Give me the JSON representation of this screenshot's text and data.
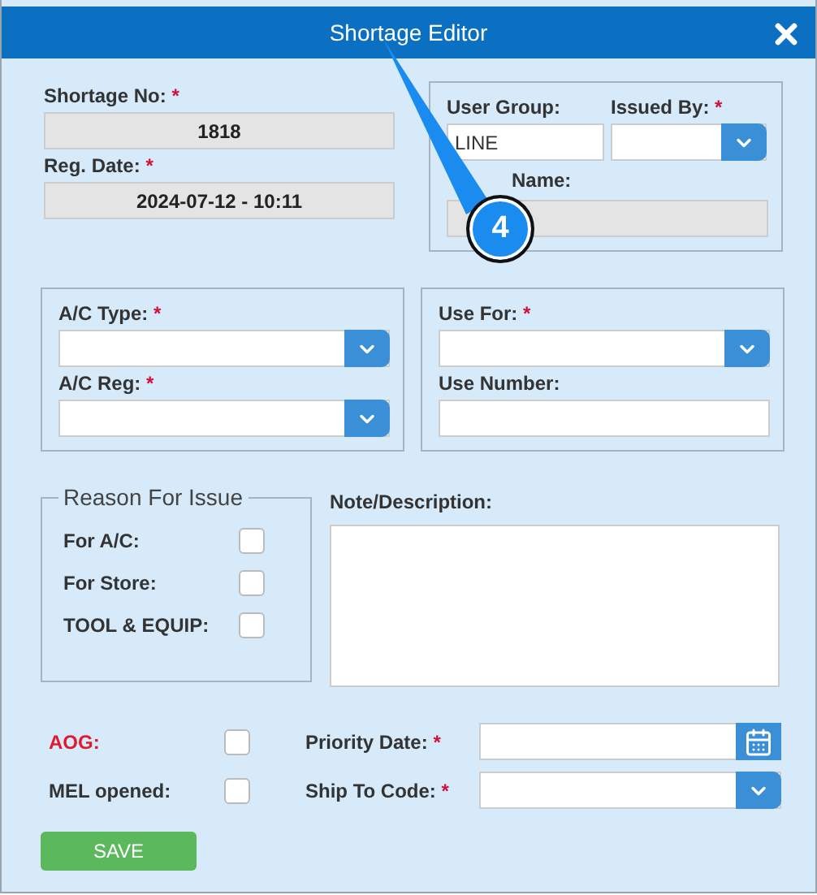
{
  "window": {
    "title": "Shortage Editor"
  },
  "shortage_no": {
    "label": "Shortage No:",
    "mark": "*",
    "kind": "readonly",
    "value": "1818"
  },
  "reg_date": {
    "label": "Reg. Date:",
    "mark": "*",
    "kind": "readonly",
    "value": "2024-07-12 - 10:11"
  },
  "user_group": {
    "label": "User Group:",
    "kind": "text",
    "value": "LINE"
  },
  "issued_by": {
    "label": "Issued By:",
    "mark": "*",
    "kind": "select"
  },
  "user_name": {
    "label": "Name:",
    "kind": "readonly"
  },
  "ac_type": {
    "label": "A/C Type:",
    "mark": "*",
    "kind": "select"
  },
  "ac_reg": {
    "label": "A/C Reg:",
    "mark": "*",
    "kind": "select"
  },
  "use_for": {
    "label": "Use For:",
    "mark": "*",
    "kind": "select"
  },
  "use_number": {
    "label": "Use Number:",
    "kind": "text"
  },
  "reason": {
    "legend": "Reason For Issue",
    "options": [
      {
        "label": "For A/C:",
        "checked": false
      },
      {
        "label": "For Store:",
        "checked": false
      },
      {
        "label": "TOOL & EQUIP:",
        "checked": false
      }
    ]
  },
  "note": {
    "label": "Note/Description:"
  },
  "flags": [
    {
      "label": "AOG:",
      "checked": false,
      "color": "#e0192e"
    },
    {
      "label": "MEL opened:",
      "checked": false,
      "color": "#333333"
    }
  ],
  "priority_date": {
    "label": "Priority Date:",
    "mark": "*",
    "kind": "date"
  },
  "ship_to_code": {
    "label": "Ship To Code:",
    "mark": "*",
    "kind": "select"
  },
  "save": "SAVE",
  "callout": {
    "label": "4"
  }
}
